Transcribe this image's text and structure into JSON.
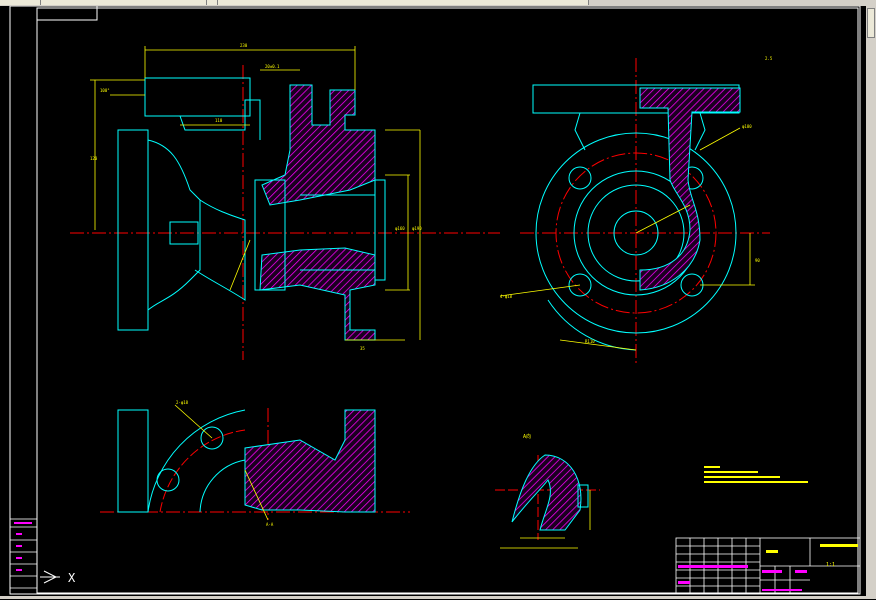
{
  "app": {
    "window": "AutoCAD drawing window",
    "model_space_icon": "ucs-icon"
  },
  "colors": {
    "background": "#000000",
    "outline": "#00ffff",
    "centerline": "#ff0000",
    "dimension": "#ffff00",
    "hatch": "#ff00ff",
    "frame": "#ffffff"
  },
  "ucs": {
    "axis_label": "X"
  },
  "title_block": {
    "scale_label": "1:1",
    "drawing_no": "",
    "cells_left": [
      "设计",
      "审核",
      "工艺"
    ]
  },
  "annotations": {
    "section_mark": "A-A",
    "view_note": "A向"
  }
}
